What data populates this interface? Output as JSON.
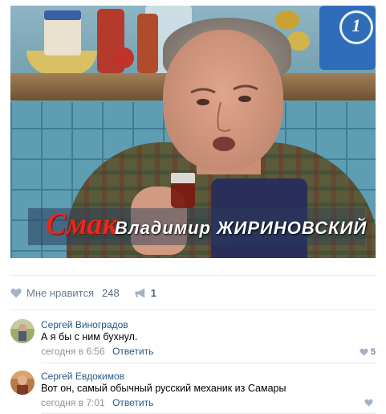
{
  "video": {
    "channel_logo": "1",
    "caption_show": "Смак",
    "caption_name": "Владимир ЖИРИНОВСКИЙ"
  },
  "post_actions": {
    "like_label": "Мне нравится",
    "like_count": "248",
    "share_count": "1",
    "like_icon": "heart-icon",
    "share_icon": "megaphone-icon"
  },
  "comments": [
    {
      "author": "Сергей Виноградов",
      "text": "А я бы с ним бухнул.",
      "time": "сегодня в 6:56",
      "reply_label": "Ответить",
      "likes": "5"
    },
    {
      "author": "Сергей Евдокимов",
      "text": "Вот он, самый обычный русский механик из Самары",
      "time": "сегодня в 7:01",
      "reply_label": "Ответить",
      "likes": ""
    }
  ],
  "colors": {
    "link": "#2a5885",
    "meta": "#939393",
    "icon": "#a3b3c4",
    "caption_red": "#e32a1d"
  }
}
